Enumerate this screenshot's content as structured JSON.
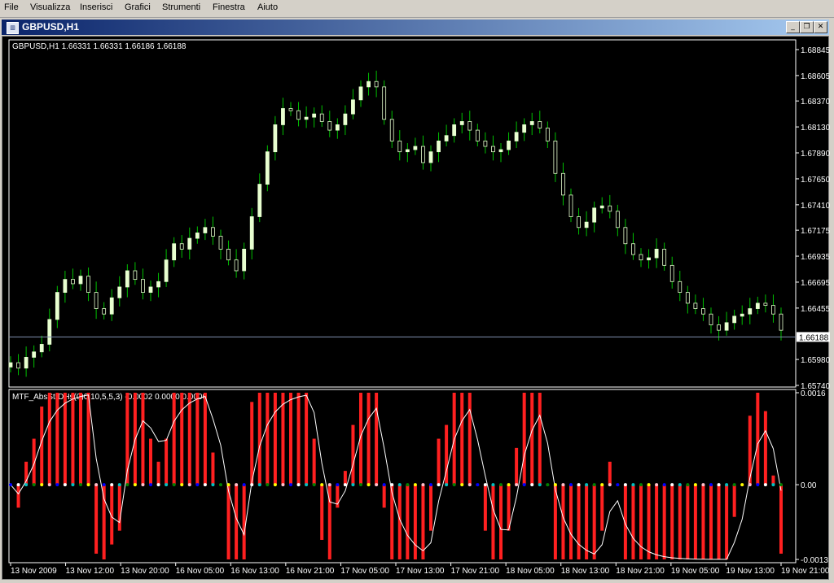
{
  "menu": [
    {
      "label": "File",
      "key": "F"
    },
    {
      "label": "Visualizza",
      "key": "V"
    },
    {
      "label": "Inserisci",
      "key": "I"
    },
    {
      "label": "Grafici",
      "key": "G"
    },
    {
      "label": "Strumenti",
      "key": "S"
    },
    {
      "label": "Finestra",
      "key": "F"
    },
    {
      "label": "Aiuto",
      "key": "A"
    }
  ],
  "window": {
    "title": "GBPUSD,H1",
    "minimize": "_",
    "restore": "❐",
    "close": "✕"
  },
  "colors": {
    "background": "#000000",
    "bull_candle": "#e8ffd0",
    "wick": "#00c000",
    "histogram": "#ff2020",
    "indicator_line": "#ffffff",
    "bid_line": "#8090b0",
    "dot_colors": [
      "#0000ff",
      "#ffffff",
      "#00c0c0",
      "#008000",
      "#ffff00",
      "#ffc0cb"
    ]
  },
  "price_chart": {
    "header": "GBPUSD,H1  1.66331 1.66331 1.66186 1.66188",
    "current_price": "1.66188",
    "current_price_value": 1.66188,
    "y_labels": [
      "1.68845",
      "1.68605",
      "1.68370",
      "1.68130",
      "1.67890",
      "1.67650",
      "1.67410",
      "1.67175",
      "1.66935",
      "1.66695",
      "1.66455",
      "1.65980",
      "1.65740"
    ],
    "y_range": [
      1.6574,
      1.6892
    ]
  },
  "indicator": {
    "header": "MTF_AbsStrDHs(0)0,10,5,5,3) -0.0002 0.0000 0.0000",
    "y_labels": [
      "0.0016",
      "0.00",
      "-0.0013"
    ],
    "y_range": [
      -0.0013,
      0.0016
    ]
  },
  "time_axis": [
    "13 Nov 2009",
    "13 Nov 12:00",
    "13 Nov 20:00",
    "16 Nov 05:00",
    "16 Nov 13:00",
    "16 Nov 21:00",
    "17 Nov 05:00",
    "17 Nov 13:00",
    "17 Nov 21:00",
    "18 Nov 05:00",
    "18 Nov 13:00",
    "18 Nov 21:00",
    "19 Nov 05:00",
    "19 Nov 13:00",
    "19 Nov 21:00"
  ],
  "chart_data": {
    "type": "candlestick",
    "close_series": [
      1.6595,
      1.659,
      1.66,
      1.6605,
      1.6612,
      1.6635,
      1.666,
      1.6672,
      1.6668,
      1.6675,
      1.666,
      1.6645,
      1.664,
      1.6655,
      1.6665,
      1.668,
      1.6672,
      1.666,
      1.6665,
      1.667,
      1.669,
      1.6705,
      1.67,
      1.671,
      1.6715,
      1.672,
      1.6712,
      1.67,
      1.669,
      1.668,
      1.67,
      1.673,
      1.676,
      1.679,
      1.6815,
      1.683,
      1.6828,
      1.682,
      1.6822,
      1.6825,
      1.6818,
      1.681,
      1.6815,
      1.6825,
      1.6838,
      1.685,
      1.6855,
      1.685,
      1.682,
      1.68,
      1.679,
      1.6792,
      1.6795,
      1.678,
      1.679,
      1.68,
      1.6805,
      1.6815,
      1.6818,
      1.681,
      1.68,
      1.6795,
      1.679,
      1.6792,
      1.68,
      1.6808,
      1.6815,
      1.6818,
      1.6812,
      1.68,
      1.677,
      1.675,
      1.673,
      1.672,
      1.6725,
      1.6738,
      1.674,
      1.6735,
      1.672,
      1.6705,
      1.6695,
      1.669,
      1.6692,
      1.67,
      1.6685,
      1.667,
      1.666,
      1.665,
      1.6645,
      1.664,
      1.663,
      1.6625,
      1.6632,
      1.6638,
      1.664,
      1.6645,
      1.665,
      1.6648,
      1.664,
      1.6625
    ]
  }
}
